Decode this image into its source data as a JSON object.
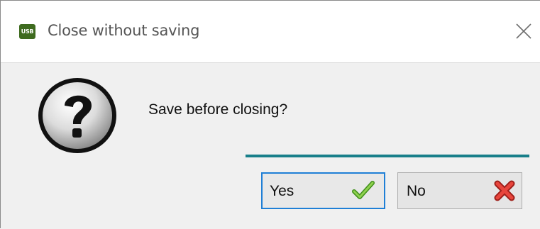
{
  "window": {
    "title": "Close without saving",
    "app_icon_text": "USB",
    "close_icon": "close-icon"
  },
  "dialog": {
    "icon": "question-icon",
    "message": "Save before closing?",
    "accent_color": "#187f8a"
  },
  "buttons": {
    "yes": {
      "label": "Yes",
      "icon": "checkmark-icon",
      "icon_color": "#5fb82c",
      "focused": true
    },
    "no": {
      "label": "No",
      "icon": "red-x-icon",
      "icon_color": "#d8332c"
    }
  }
}
